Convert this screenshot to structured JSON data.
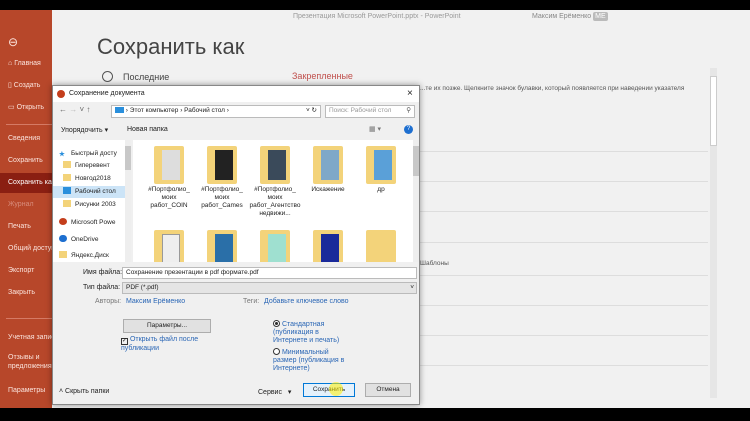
{
  "window": {
    "title": "Презентация Microsoft PowerPoint.pptx - PowerPoint",
    "user": "Максим Ерёменко",
    "user_initials": "МЕ"
  },
  "sidebar": {
    "items": [
      {
        "label": "Главная",
        "icon": "home-icon"
      },
      {
        "label": "Создать",
        "icon": "new-doc-icon"
      },
      {
        "label": "Открыть",
        "icon": "folder-open-icon"
      },
      {
        "label": "Сведения"
      },
      {
        "label": "Сохранить"
      },
      {
        "label": "Сохранить как",
        "selected": true
      },
      {
        "label": "Журнал",
        "disabled": true
      },
      {
        "label": "Печать"
      },
      {
        "label": "Общий доступ"
      },
      {
        "label": "Экспорт"
      },
      {
        "label": "Закрыть"
      },
      {
        "label": "Учетная запись"
      },
      {
        "label": "Отзывы и предложения"
      },
      {
        "label": "Параметры"
      }
    ]
  },
  "page": {
    "title": "Сохранить как",
    "recent": "Последние",
    "pinned": "Закрепленные",
    "pin_note": "...те их позже. Щелкните значок булавки, который появляется при наведении указателя",
    "templates": "Шаблоны"
  },
  "dialog": {
    "title": "Сохранение документа",
    "path": [
      "Этот компьютер",
      "Рабочий стол"
    ],
    "search_placeholder": "Поиск: Рабочий стол",
    "organize": "Упорядочить ▾",
    "new_folder": "Новая папка",
    "nav": [
      "Быстрый досту",
      "Гиперевент",
      "Новгод2018",
      "Рабочий стол",
      "Рисунки 2003",
      "Microsoft Powe",
      "OneDrive",
      "Яндекс.Диск"
    ],
    "files": [
      "#Портфолио_ моих работ_COIN",
      "#Портфолио_ моих работ_Cames",
      "#Портфолио_ моих работ_Агентство недвижи...",
      "Искажение",
      "др",
      "",
      "",
      "",
      "",
      ""
    ],
    "filename_label": "Имя файла:",
    "filename": "Сохранение презентации в pdf формате.pdf",
    "filetype_label": "Тип файла:",
    "filetype": "PDF (*.pdf)",
    "authors_label": "Авторы:",
    "authors": "Максим Ерёменко",
    "tags_label": "Теги:",
    "tags": "Добавьте ключевое слово",
    "params": "Параметры...",
    "open_after": "Открыть файл после публикации",
    "open_after_checked": true,
    "opt_standard": "Стандартная (публикация в Интернете и печать)",
    "opt_min": "Минимальный размер (публикация в Интернете)",
    "selected_option": "standard",
    "hide_folders": "Скрыть папки",
    "service": "Сервис",
    "save": "Сохранить",
    "cancel": "Отмена"
  }
}
